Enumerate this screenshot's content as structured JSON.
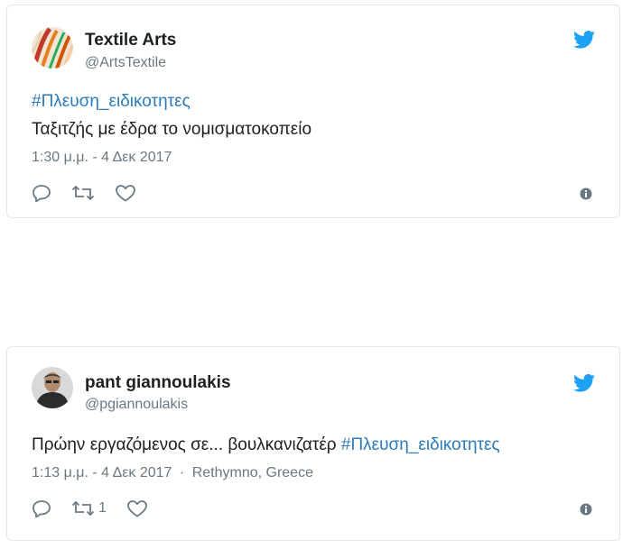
{
  "colors": {
    "accent": "#1da1f2",
    "link": "#2b7bb9",
    "muted": "#697882",
    "text": "#1c2022"
  },
  "tweets": [
    {
      "author_name": "Textile Arts",
      "author_handle": "@ArtsTextile",
      "hashtag": "#Πλευση_ειδικοτητες",
      "body": "Ταξιτζής με έδρα το νομισματοκοπείο",
      "timestamp": "1:30 μ.μ. - 4 Δεκ 2017",
      "icons": [
        "reply-icon",
        "retweet-icon",
        "like-icon",
        "info-icon",
        "twitter-bird-icon"
      ]
    },
    {
      "author_name": "pant giannoulakis",
      "author_handle": "@pgiannoulakis",
      "body": "Πρώην εργαζόμενος σε... βουλκανιζατέρ ",
      "hashtag": "#Πλευση_ειδικοτητες",
      "timestamp": "1:13 μ.μ. - 4 Δεκ 2017",
      "separator": "·",
      "location": "Rethymno, Greece",
      "retweet_count": "1",
      "icons": [
        "reply-icon",
        "retweet-icon",
        "like-icon",
        "info-icon",
        "twitter-bird-icon"
      ]
    }
  ]
}
